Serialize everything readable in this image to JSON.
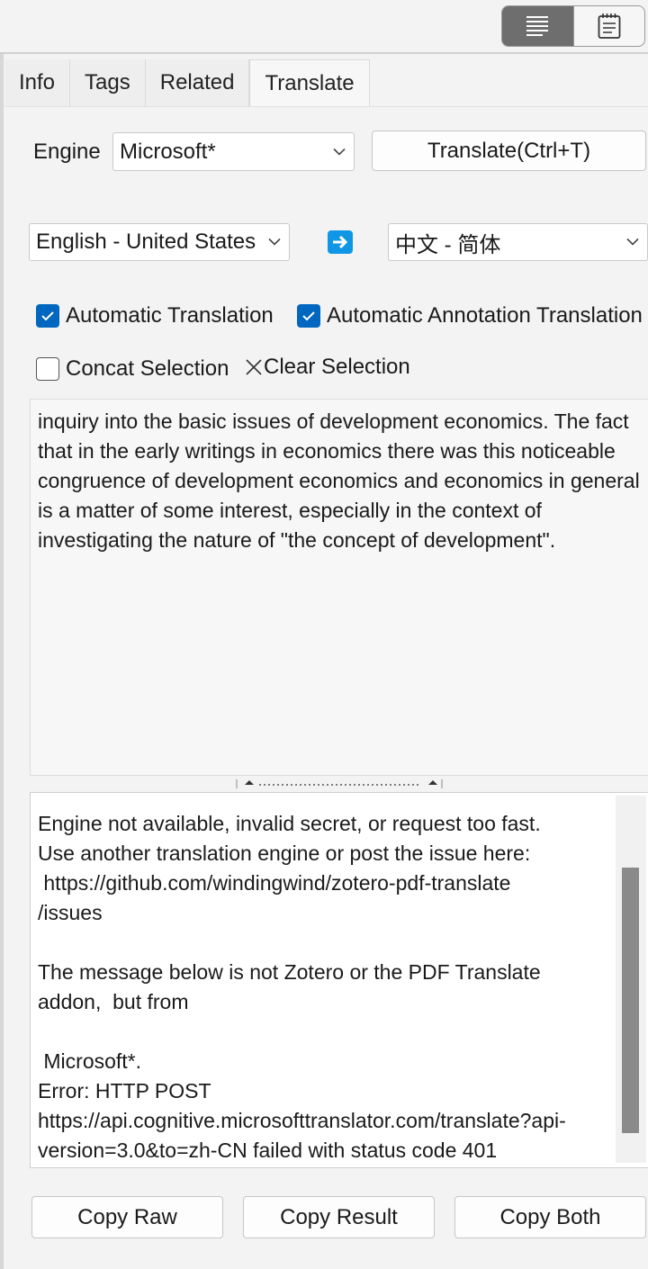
{
  "toolbar": {
    "view_modes": [
      {
        "icon": "list-lines-icon",
        "active": true
      },
      {
        "icon": "notepad-icon",
        "active": false
      }
    ]
  },
  "tabs": [
    {
      "label": "Info",
      "selected": false
    },
    {
      "label": "Tags",
      "selected": false
    },
    {
      "label": "Related",
      "selected": false
    },
    {
      "label": "Translate",
      "selected": true
    }
  ],
  "engine": {
    "label": "Engine",
    "selected": "Microsoft*",
    "translate_button": "Translate(Ctrl+T)"
  },
  "languages": {
    "source": "English - United States",
    "target": "中文 - 简体",
    "arrow_icon": "right-arrow-icon"
  },
  "options": {
    "auto_translation": {
      "label": "Automatic Translation",
      "checked": true
    },
    "auto_annotation": {
      "label": "Automatic Annotation Translation",
      "checked": true
    },
    "concat": {
      "label": "Concat Selection",
      "checked": false
    },
    "clear_label": "Clear Selection"
  },
  "source_text": "inquiry into the basic issues of development economics. The fact that in the early writings in economics there was this noticeable congruence of development economics and economics in general is a matter of some interest, especially in the context of investigating the nature of \"the concept of development\".",
  "result_lines": [
    "Engine not available, invalid secret, or request too fast.",
    "Use another translation engine or post the issue here:",
    " https://github.com/windingwind/zotero-pdf-translate",
    "/issues",
    "",
    "The message below is not Zotero or the PDF Translate",
    "addon,  but from",
    "",
    " Microsoft*.",
    "Error: HTTP POST",
    "https://api.cognitive.microsofttranslator.com/translate?api-",
    "version=3.0&to=zh-CN failed with status code 401"
  ],
  "actions": {
    "copy_raw": "Copy Raw",
    "copy_result": "Copy Result",
    "copy_both": "Copy Both"
  },
  "colors": {
    "accent": "#0067c0",
    "arrow": "#0f97e6"
  }
}
